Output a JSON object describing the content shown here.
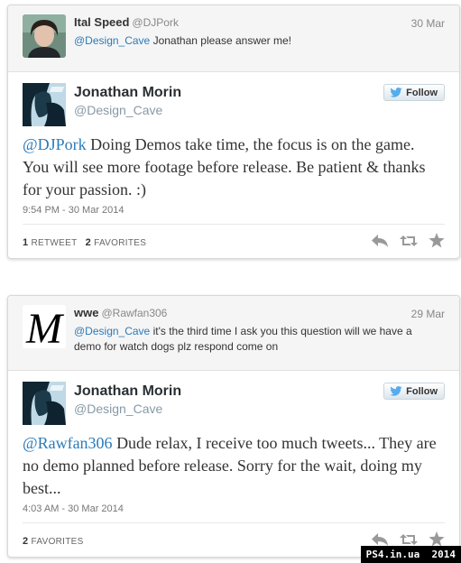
{
  "tweets": [
    {
      "reply": {
        "name": "Ital Speed",
        "handle": "@DJPork",
        "date": "30 Mar",
        "mention": "@Design_Cave",
        "text": " Jonathan please answer me!"
      },
      "main": {
        "name": "Jonathan Morin",
        "handle": "@Design_Cave",
        "follow_label": "Follow",
        "mention": "@DJPork",
        "text": " Doing Demos take time, the focus is on the game. You will see more footage before release. Be patient & thanks for your passion. :)",
        "time": "9:54 PM - 30 Mar 2014",
        "retweets_count": "1",
        "retweets_label": "RETWEET",
        "favorites_count": "2",
        "favorites_label": "FAVORITES"
      }
    },
    {
      "reply": {
        "name": "wwe",
        "handle": "@Rawfan306",
        "date": "29 Mar",
        "mention": "@Design_Cave",
        "text": " it's the third time I ask you this question will we have a demo for watch dogs plz respond come on"
      },
      "main": {
        "name": "Jonathan Morin",
        "handle": "@Design_Cave",
        "follow_label": "Follow",
        "mention": "@Rawfan306",
        "text": " Dude relax, I receive too much tweets... They are no demo planned before release. Sorry for the wait, doing my best...",
        "time": "4:03 AM - 30 Mar 2014",
        "favorites_count": "2",
        "favorites_label": "FAVORITES"
      }
    }
  ],
  "watermark": "PS4.in.ua  2014",
  "colors": {
    "link": "#2b7bb9",
    "twitter_blue": "#55acee"
  },
  "icons": [
    "twitter-bird-icon",
    "reply-icon",
    "retweet-icon",
    "favorite-star-icon"
  ]
}
